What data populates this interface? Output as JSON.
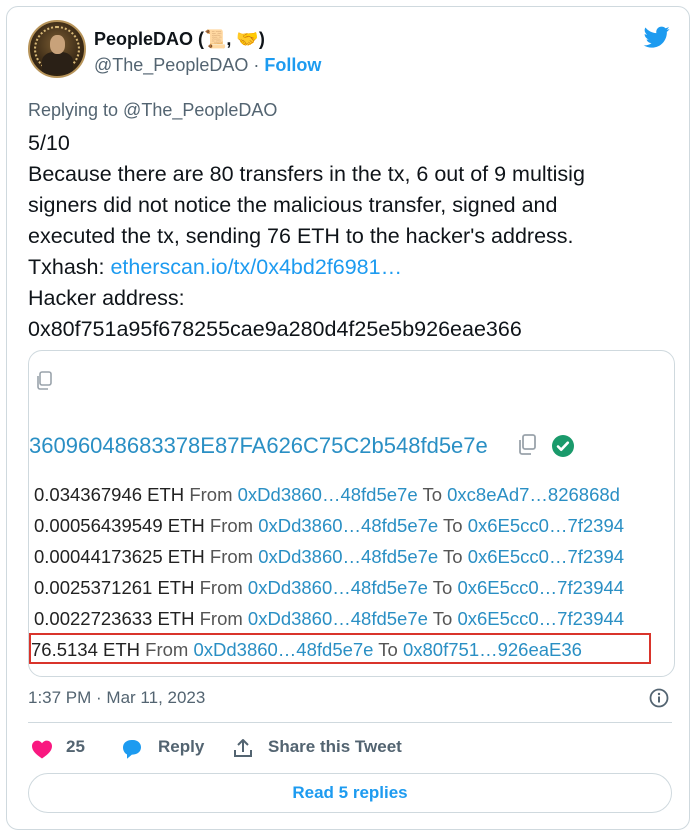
{
  "author": {
    "name": "PeopleDAO (📜, 🤝)",
    "handle": "@The_PeopleDAO",
    "separator": "·",
    "follow_label": "Follow"
  },
  "reply_to": "Replying to @The_PeopleDAO",
  "tweet": {
    "lines": [
      "5/10",
      "Because there are 80 transfers in the tx, 6 out of 9 multisig",
      "signers did not notice the malicious transfer, signed and",
      "executed the tx, sending 76 ETH to the hacker's address."
    ],
    "txhash_label": "Txhash: ",
    "txhash_link": "etherscan.io/tx/0x4bd2f6981…",
    "hacker_label": "Hacker address:",
    "hacker_address": "0x80f751a95f678255cae9a280d4f25e5b926eae366"
  },
  "media": {
    "address_fragment": "36096048683378E87FA626C75C2b548fd5e7e",
    "transfers": [
      {
        "amount": "0.034367946 ETH",
        "from_label": "From",
        "from": "0xDd3860…48fd5e7e",
        "to_label": "To",
        "to": "0xc8eAd7…826868d"
      },
      {
        "amount": "0.00056439549 ETH",
        "from_label": "From",
        "from": "0xDd3860…48fd5e7e",
        "to_label": "To",
        "to": "0x6E5cc0…7f2394"
      },
      {
        "amount": "0.00044173625 ETH",
        "from_label": "From",
        "from": "0xDd3860…48fd5e7e",
        "to_label": "To",
        "to": "0x6E5cc0…7f2394"
      },
      {
        "amount": "0.0025371261 ETH",
        "from_label": "From",
        "from": "0xDd3860…48fd5e7e",
        "to_label": "To",
        "to": "0x6E5cc0…7f23944"
      },
      {
        "amount": "0.0022723633 ETH",
        "from_label": "From",
        "from": "0xDd3860…48fd5e7e",
        "to_label": "To",
        "to": "0x6E5cc0…7f23944"
      },
      {
        "amount": "76.5134 ETH",
        "from_label": "From",
        "from": "0xDd3860…48fd5e7e",
        "to_label": "To",
        "to": "0x80f751…926eaE36"
      }
    ],
    "highlight_color": "#d9342b"
  },
  "timestamp": "1:37 PM · Mar 11, 2023",
  "actions": {
    "like_count": "25",
    "reply_label": "Reply",
    "share_label": "Share this Tweet"
  },
  "read_replies_label": "Read 5 replies",
  "colors": {
    "accent": "#1d9bf0",
    "like": "#f91880",
    "muted": "#536471"
  }
}
